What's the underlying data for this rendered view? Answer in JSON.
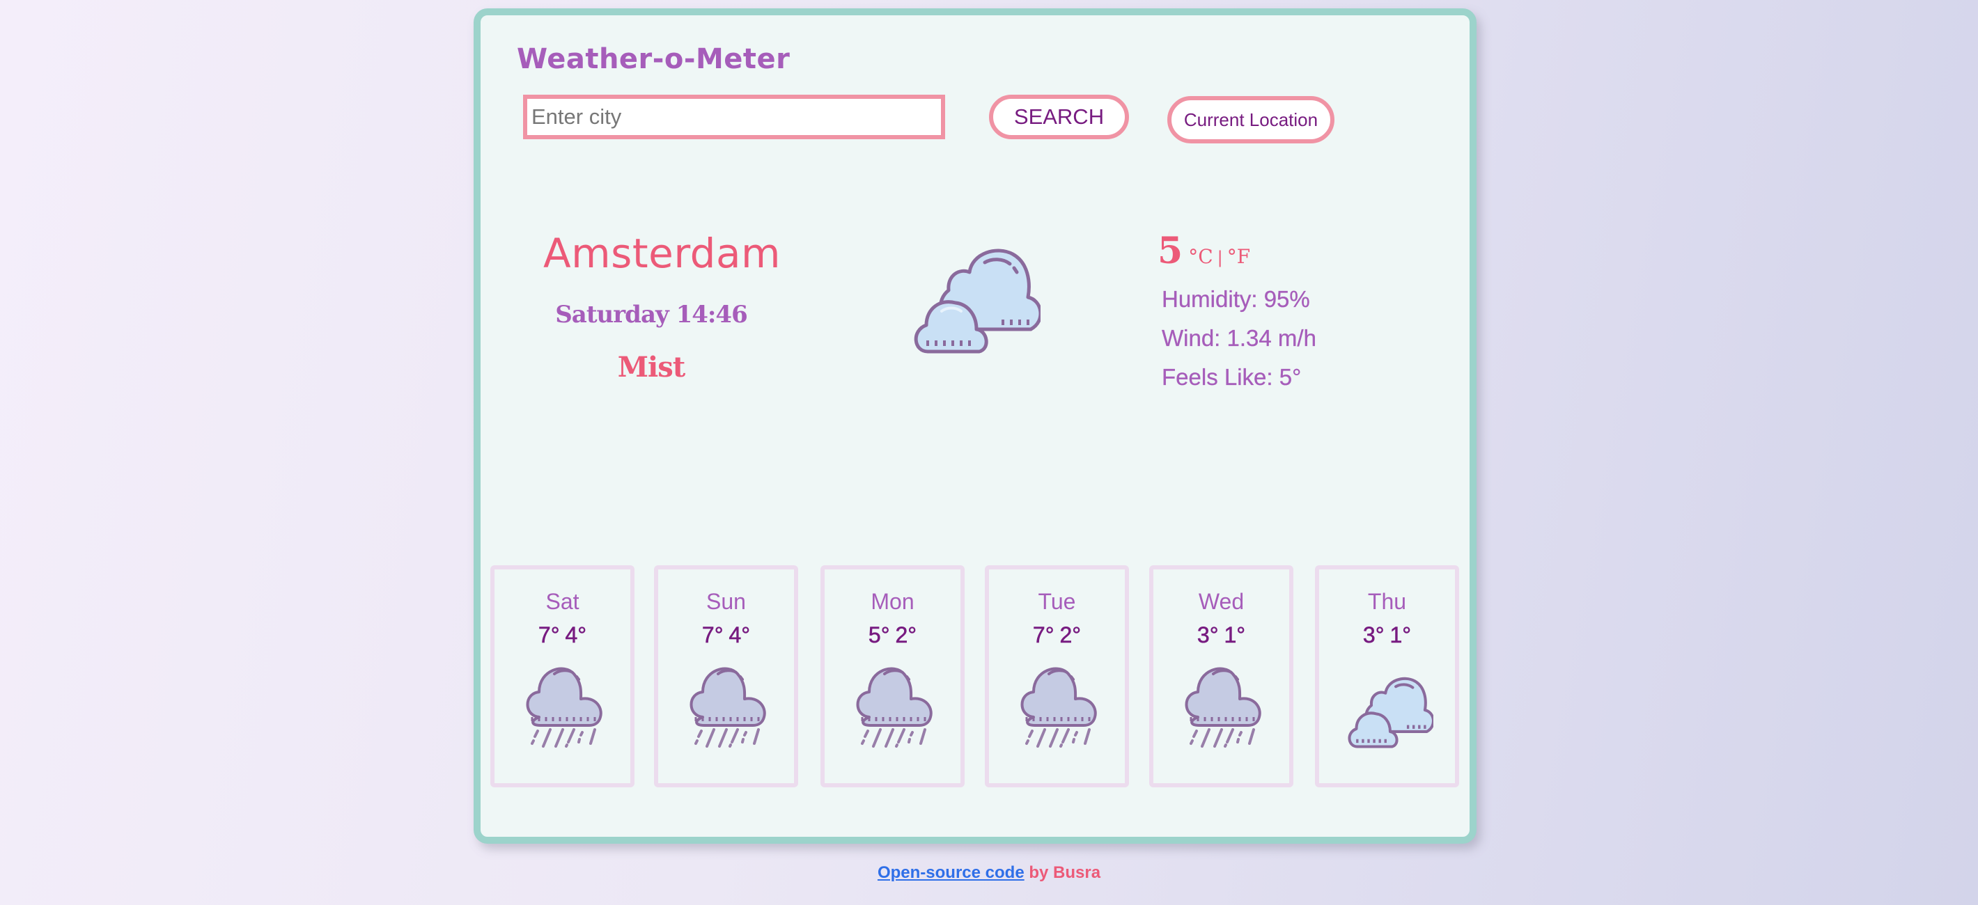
{
  "app": {
    "title": "Weather-o-Meter"
  },
  "search": {
    "placeholder": "Enter city",
    "value": "",
    "search_label": "SEARCH",
    "current_location_label": "Current Location"
  },
  "current": {
    "city": "Amsterdam",
    "datetime": "Saturday 14:46",
    "description": "Mist",
    "icon": "clouds-icon",
    "temperature": "5",
    "unit_celsius": "°C",
    "unit_separator": "|",
    "unit_fahrenheit": "°F",
    "humidity": "Humidity: 95%",
    "wind": "Wind: 1.34 m/h",
    "feels_like": "Feels Like: 5°"
  },
  "forecast": [
    {
      "day": "Sat",
      "max": "7°",
      "min": "4°",
      "icon": "rain-icon"
    },
    {
      "day": "Sun",
      "max": "7°",
      "min": "4°",
      "icon": "rain-icon"
    },
    {
      "day": "Mon",
      "max": "5°",
      "min": "2°",
      "icon": "rain-icon"
    },
    {
      "day": "Tue",
      "max": "7°",
      "min": "2°",
      "icon": "rain-icon"
    },
    {
      "day": "Wed",
      "max": "3°",
      "min": "1°",
      "icon": "rain-icon"
    },
    {
      "day": "Thu",
      "max": "3°",
      "min": "1°",
      "icon": "clouds-icon"
    }
  ],
  "footer": {
    "link_text": "Open-source code",
    "by_text": "by Busra"
  },
  "colors": {
    "card_border": "#9cd3cb",
    "accent_pink": "#ec5a78",
    "accent_purple": "#a65dba",
    "dark_purple": "#771b80",
    "button_border": "#f093a4",
    "link_blue": "#2f6fe8"
  }
}
